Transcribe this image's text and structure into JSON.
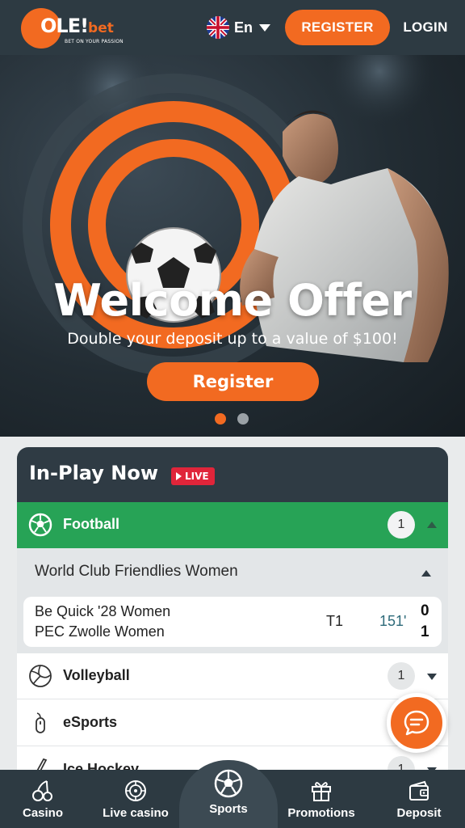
{
  "brand": {
    "name": "OLE!",
    "suffix": "bet",
    "tagline": "BET ON YOUR PASSION",
    "accent": "#f26a21"
  },
  "header": {
    "language": "En",
    "register_label": "REGISTER",
    "login_label": "LOGIN"
  },
  "hero": {
    "title": "Welcome Offer",
    "subtitle": "Double your deposit up to a value of $100!",
    "cta_label": "Register",
    "slide_count": 2,
    "active_slide": 1
  },
  "inplay": {
    "title": "In-Play Now",
    "live_badge": "LIVE",
    "sports": [
      {
        "label": "Football",
        "count": "1",
        "icon": "football-icon",
        "expanded": true
      },
      {
        "label": "Volleyball",
        "count": "1",
        "icon": "volleyball-icon",
        "expanded": false
      },
      {
        "label": "eSports",
        "count": "1",
        "icon": "esports-icon",
        "expanded": false
      },
      {
        "label": "Ice Hockey",
        "count": "1",
        "icon": "ice-hockey-icon",
        "expanded": false
      }
    ],
    "league": {
      "title": "World Club Friendlies Women",
      "match": {
        "home": "Be Quick '28 Women",
        "away": "PEC Zwolle Women",
        "period": "T1",
        "minute": "151'",
        "home_score": "0",
        "away_score": "1"
      }
    }
  },
  "bottom_nav": {
    "items": [
      {
        "label": "Casino",
        "icon": "cherries-icon"
      },
      {
        "label": "Live casino",
        "icon": "roulette-icon"
      },
      {
        "label": "Sports",
        "icon": "football-icon",
        "active": true
      },
      {
        "label": "Promotions",
        "icon": "gift-icon"
      },
      {
        "label": "Deposit",
        "icon": "wallet-icon"
      }
    ]
  },
  "colors": {
    "header_bg": "#2d3a42",
    "live_green": "#27a356",
    "live_red": "#e0253a"
  }
}
